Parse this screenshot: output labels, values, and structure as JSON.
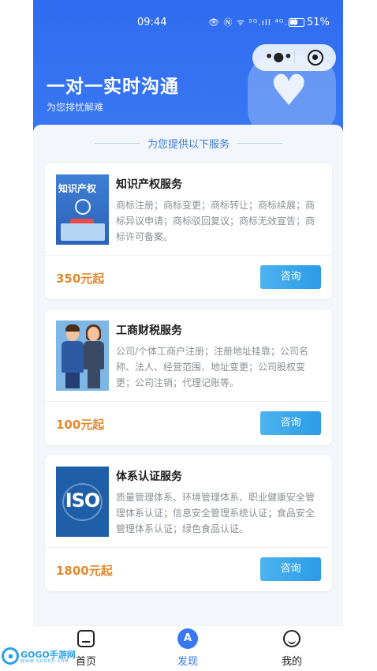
{
  "status_bar": {
    "time": "09:44",
    "icons": "👁 Ⓝ ᯤ ⁵ᴳ.ıll ⁴ᴳ.ıll",
    "battery": "51%"
  },
  "hero": {
    "title": "一对一实时沟通",
    "subtitle": "为您排忧解难",
    "capsule_more": "•●•",
    "accent_color": "#2f6cf0"
  },
  "section": {
    "title": "为您提供以下服务"
  },
  "services": [
    {
      "title": "知识产权服务",
      "thumb_label": "知识产权",
      "description": "商标注册；商标变更；商标转让；商标续展；商标异议申请；商标驳回复议；商标无效宣告；商标许可备案。",
      "price": "350元起",
      "button": "咨询"
    },
    {
      "title": "工商财税服务",
      "description": "公司/个体工商户注册；注册地址挂靠；公司名称、法人、经营范围、地址变更；公司股权变更；公司注销；代理记账等。",
      "price": "100元起",
      "button": "咨询"
    },
    {
      "title": "体系认证服务",
      "thumb_label": "ISO",
      "description": "质量管理体系、环境管理体系、职业健康安全管理体系认证；信息安全管理系统认证；食品安全管理体系认证；绿色食品认证。",
      "price": "1800元起",
      "button": "咨询"
    }
  ],
  "tabbar": {
    "items": [
      {
        "label": "首页",
        "icon": "home-icon"
      },
      {
        "label": "发现",
        "icon": "discover-icon",
        "active": true
      },
      {
        "label": "我的",
        "icon": "profile-icon"
      }
    ],
    "discover_glyph": "A"
  },
  "watermark": {
    "text": "GOGO手游网",
    "url": "WWW.GOGOO.COM"
  }
}
